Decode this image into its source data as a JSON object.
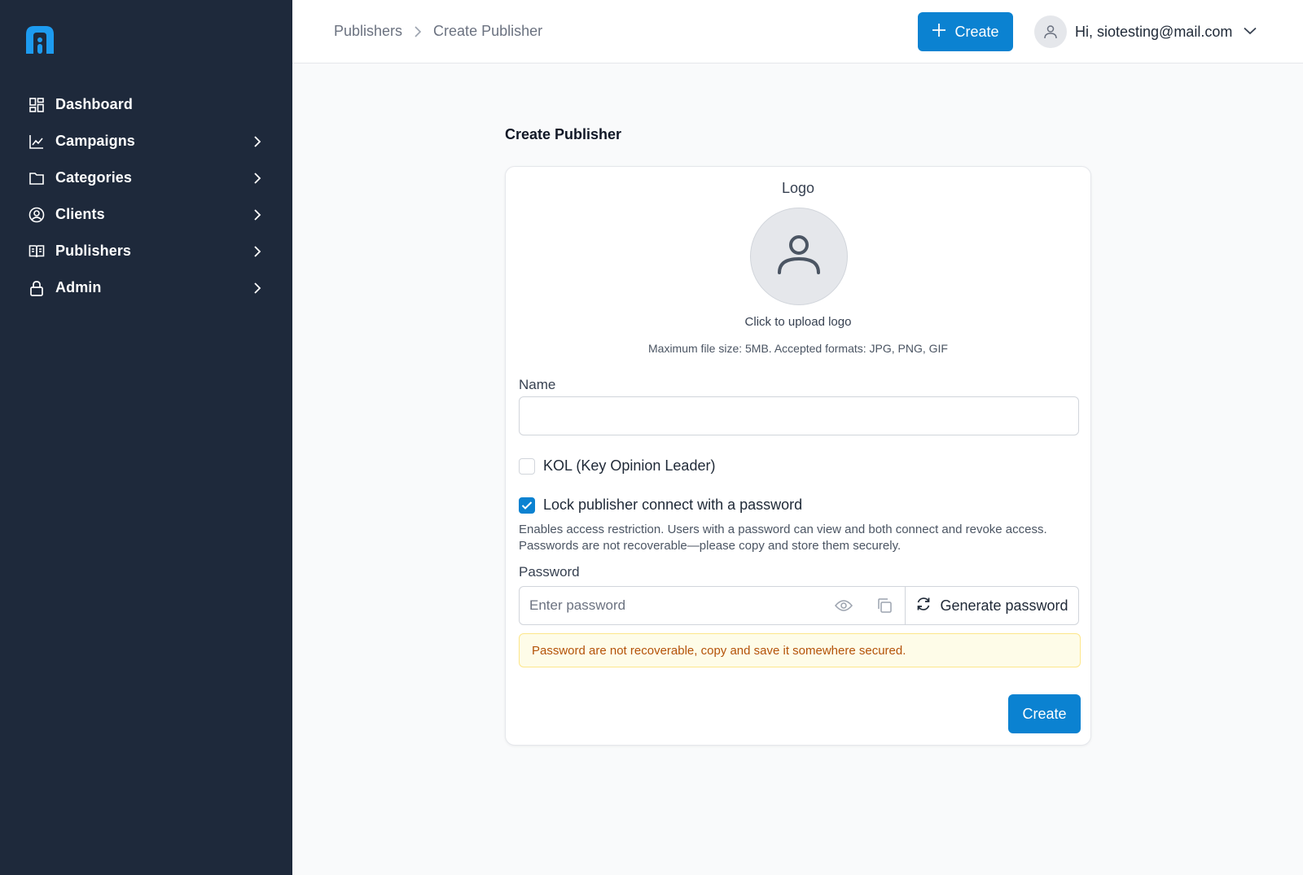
{
  "sidebar": {
    "items": [
      {
        "label": "Dashboard",
        "icon": "dashboard-icon",
        "has_children": false
      },
      {
        "label": "Campaigns",
        "icon": "chart-line-icon",
        "has_children": true
      },
      {
        "label": "Categories",
        "icon": "folder-icon",
        "has_children": true
      },
      {
        "label": "Clients",
        "icon": "user-circle-icon",
        "has_children": true
      },
      {
        "label": "Publishers",
        "icon": "book-open-icon",
        "has_children": true
      },
      {
        "label": "Admin",
        "icon": "lock-icon",
        "has_children": true
      }
    ]
  },
  "header": {
    "breadcrumb": [
      "Publishers",
      "Create Publisher"
    ],
    "create_label": "Create",
    "greeting": "Hi, siotesting@mail.com"
  },
  "main": {
    "title": "Create Publisher",
    "logo": {
      "label": "Logo",
      "upload_text": "Click to upload logo",
      "hint": "Maximum file size: 5MB. Accepted formats: JPG, PNG, GIF"
    },
    "name": {
      "label": "Name",
      "value": "",
      "placeholder": ""
    },
    "kol": {
      "label": "KOL (Key Opinion Leader)",
      "checked": false
    },
    "lock": {
      "label": "Lock publisher connect with a password",
      "checked": true,
      "description": "Enables access restriction. Users with a password can view and both connect and revoke access. Passwords are not recoverable—please copy and store them securely."
    },
    "password": {
      "label": "Password",
      "placeholder": "Enter password",
      "value": "",
      "generate_label": "Generate password"
    },
    "warning": "Password are not recoverable, copy and save it somewhere secured.",
    "submit_label": "Create"
  },
  "colors": {
    "sidebar_bg": "#1e293b",
    "accent": "#0b82d1",
    "warning_bg": "#fefce8",
    "warning_text": "#b45309"
  }
}
